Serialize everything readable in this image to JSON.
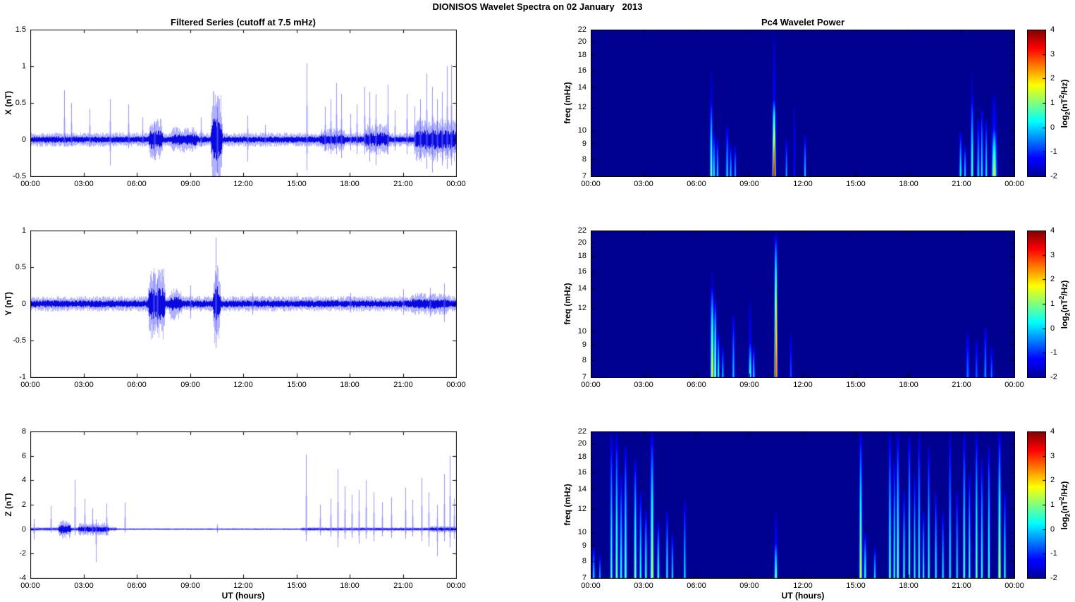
{
  "figure": {
    "title": "DIONISOS Wavelet Spectra on 02 January   2013",
    "background_color": "#ffffff",
    "series_color": "#0000ee",
    "frame_color": "#000000",
    "heatmap_background": "#00008f"
  },
  "chart_data": [
    {
      "id": "x-filtered-series",
      "type": "line",
      "title": "Filtered Series (cutoff at 7.5 mHz)",
      "xlabel": "",
      "ylabel": "X (nT)",
      "xlim_hours": [
        0,
        24
      ],
      "x_tick_labels": [
        "00:00",
        "03:00",
        "06:00",
        "09:00",
        "12:00",
        "15:00",
        "18:00",
        "21:00",
        "00:00"
      ],
      "ylim": [
        -0.5,
        1.5
      ],
      "y_tick_labels": [
        "1.5",
        "1",
        "0.5",
        "0",
        "-0.5"
      ],
      "seed": 7,
      "noise_base": 0.055,
      "noise_bursts": [
        [
          6.75,
          7.35,
          0.16
        ],
        [
          8.0,
          9.3,
          0.1
        ],
        [
          10.25,
          10.7,
          0.38
        ],
        [
          16.4,
          17.6,
          0.09
        ],
        [
          18.9,
          20.1,
          0.12
        ],
        [
          21.7,
          23.9,
          0.17
        ]
      ],
      "spikes": [
        [
          1.9,
          0.67,
          -0.1
        ],
        [
          2.3,
          0.5,
          -0.08
        ],
        [
          3.35,
          0.42,
          -0.1
        ],
        [
          4.5,
          0.55,
          -0.35
        ],
        [
          5.5,
          0.48,
          -0.12
        ],
        [
          6.3,
          0.3,
          -0.1
        ],
        [
          7.0,
          0.25,
          -0.28
        ],
        [
          9.6,
          0.3,
          -0.1
        ],
        [
          10.5,
          0.45,
          -0.45
        ],
        [
          12.2,
          0.33,
          -0.3
        ],
        [
          13.2,
          0.2,
          -0.1
        ],
        [
          15.55,
          1.04,
          -0.42
        ],
        [
          16.6,
          0.45,
          -0.15
        ],
        [
          16.9,
          0.55,
          -0.2
        ],
        [
          17.2,
          0.77,
          -0.2
        ],
        [
          17.5,
          0.62,
          -0.25
        ],
        [
          18.0,
          0.35,
          -0.15
        ],
        [
          18.35,
          0.48,
          -0.2
        ],
        [
          18.8,
          0.72,
          -0.2
        ],
        [
          19.1,
          0.65,
          -0.3
        ],
        [
          19.45,
          0.62,
          -0.35
        ],
        [
          20.1,
          0.75,
          -0.2
        ],
        [
          20.5,
          0.4,
          -0.15
        ],
        [
          21.2,
          0.62,
          -0.2
        ],
        [
          21.6,
          0.45,
          -0.2
        ],
        [
          21.95,
          0.55,
          -0.25
        ],
        [
          22.3,
          0.9,
          -0.4
        ],
        [
          22.6,
          0.72,
          -0.45
        ],
        [
          22.9,
          0.55,
          -0.3
        ],
        [
          23.15,
          0.65,
          -0.35
        ],
        [
          23.45,
          1.0,
          -0.4
        ],
        [
          23.7,
          1.02,
          -0.35
        ]
      ]
    },
    {
      "id": "y-filtered-series",
      "type": "line",
      "title": "",
      "xlabel": "",
      "ylabel": "Y (nT)",
      "xlim_hours": [
        0,
        24
      ],
      "x_tick_labels": [
        "00:00",
        "03:00",
        "06:00",
        "09:00",
        "12:00",
        "15:00",
        "18:00",
        "21:00",
        "00:00"
      ],
      "ylim": [
        -1,
        1
      ],
      "y_tick_labels": [
        "1",
        "0.5",
        "0",
        "-0.5",
        "-1"
      ],
      "seed": 8,
      "noise_base": 0.06,
      "noise_bursts": [
        [
          6.7,
          7.5,
          0.28
        ],
        [
          7.9,
          8.4,
          0.13
        ],
        [
          10.35,
          10.6,
          0.3
        ],
        [
          21.5,
          23.5,
          0.085
        ]
      ],
      "spikes": [
        [
          6.95,
          0.42,
          -0.42
        ],
        [
          7.15,
          0.35,
          -0.3
        ],
        [
          9.0,
          0.25,
          -0.2
        ],
        [
          10.45,
          0.9,
          -0.6
        ],
        [
          12.5,
          0.15,
          -0.15
        ],
        [
          18.0,
          0.15,
          -0.12
        ],
        [
          21.0,
          0.2,
          -0.15
        ],
        [
          22.5,
          0.22,
          -0.18
        ],
        [
          23.3,
          0.28,
          -0.25
        ]
      ]
    },
    {
      "id": "z-filtered-series",
      "type": "line",
      "title": "",
      "xlabel": "UT (hours)",
      "ylabel": "Z (nT)",
      "xlim_hours": [
        0,
        24
      ],
      "x_tick_labels": [
        "00:00",
        "03:00",
        "06:00",
        "09:00",
        "12:00",
        "15:00",
        "18:00",
        "21:00",
        "00:00"
      ],
      "ylim": [
        -4,
        8
      ],
      "y_tick_labels": [
        "8",
        "6",
        "4",
        "2",
        "0",
        "-2",
        "-4"
      ],
      "seed": 9,
      "noise_base": 0.05,
      "noise_bursts": [
        [
          0.0,
          4.8,
          0.1
        ],
        [
          1.65,
          2.2,
          0.45
        ],
        [
          2.75,
          4.35,
          0.3
        ],
        [
          15.3,
          24,
          0.1
        ],
        [
          22.5,
          23.9,
          0.16
        ]
      ],
      "spikes": [
        [
          0.2,
          0.85,
          -0.85
        ],
        [
          1.15,
          1.9,
          -0.3
        ],
        [
          2.5,
          4.05,
          -0.5
        ],
        [
          3.05,
          2.5,
          -0.4
        ],
        [
          3.5,
          1.7,
          -0.4
        ],
        [
          3.7,
          0.8,
          -2.7
        ],
        [
          4.3,
          2.1,
          -0.5
        ],
        [
          5.3,
          2.2,
          -0.3
        ],
        [
          10.5,
          0.4,
          -0.3
        ],
        [
          15.5,
          6.1,
          -1.0
        ],
        [
          16.3,
          2.0,
          -0.5
        ],
        [
          16.9,
          2.5,
          -0.6
        ],
        [
          17.3,
          4.9,
          -1.5
        ],
        [
          17.7,
          3.5,
          -0.8
        ],
        [
          18.1,
          2.8,
          -0.7
        ],
        [
          18.5,
          3.2,
          -1.2
        ],
        [
          18.9,
          4.0,
          -0.8
        ],
        [
          19.3,
          3.0,
          -1.0
        ],
        [
          19.8,
          2.2,
          -0.6
        ],
        [
          20.3,
          2.6,
          -0.7
        ],
        [
          21.1,
          3.4,
          -0.8
        ],
        [
          21.5,
          2.4,
          -0.6
        ],
        [
          22.0,
          4.2,
          -1.0
        ],
        [
          22.4,
          3.0,
          -1.4
        ],
        [
          22.9,
          2.0,
          -2.2
        ],
        [
          23.3,
          4.5,
          -1.0
        ],
        [
          23.6,
          6.0,
          -1.5
        ],
        [
          23.85,
          2.5,
          -0.8
        ]
      ]
    },
    {
      "id": "x-wavelet-power",
      "type": "heatmap",
      "title": "Pc4 Wavelet Power",
      "xlabel": "",
      "ylabel": "freq (mHz)",
      "xlim_hours": [
        0,
        24
      ],
      "x_tick_labels": [
        "00:00",
        "03:00",
        "06:00",
        "09:00",
        "12:00",
        "15:00",
        "18:00",
        "21:00",
        "00:00"
      ],
      "freq_lim_mhz": [
        7,
        22
      ],
      "y_tick_labels": [
        "22",
        "20",
        "18",
        "16",
        "14",
        "12",
        "10",
        "9",
        "8",
        "7"
      ],
      "colorbar": {
        "min": -2,
        "max": 4,
        "tick_labels": [
          "4",
          "3",
          "2",
          "1",
          "0",
          "-1",
          "-2"
        ],
        "label_plain": "log2(nT^2/Hz)",
        "label_parts": {
          "prefix": "log",
          "sub": "2",
          "mid": "(nT",
          "sup": "2",
          "suffix": "/Hz)"
        }
      },
      "events": [
        [
          6.8,
          1.3,
          13,
          0.05
        ],
        [
          6.8,
          -0.9,
          16.5,
          0.05
        ],
        [
          6.95,
          0.7,
          10,
          0.04
        ],
        [
          7.15,
          0.4,
          9.5,
          0.04
        ],
        [
          7.7,
          0.3,
          10.5,
          0.05
        ],
        [
          7.9,
          0.25,
          9,
          0.04
        ],
        [
          8.15,
          0.1,
          9,
          0.04
        ],
        [
          10.35,
          3.9,
          13,
          0.055
        ],
        [
          10.35,
          -0.7,
          22,
          0.05
        ],
        [
          11.05,
          0.0,
          9.5,
          0.04
        ],
        [
          11.5,
          -1.0,
          12.5,
          0.035
        ],
        [
          12.1,
          0.3,
          9.8,
          0.04
        ],
        [
          20.9,
          0.5,
          10,
          0.05
        ],
        [
          21.15,
          0.4,
          9,
          0.04
        ],
        [
          21.55,
          1.0,
          13.5,
          0.05
        ],
        [
          21.55,
          -1.0,
          16,
          0.05
        ],
        [
          21.9,
          0.3,
          11,
          0.05
        ],
        [
          22.1,
          0.6,
          12,
          0.04
        ],
        [
          22.35,
          0.5,
          11,
          0.04
        ],
        [
          22.8,
          1.7,
          10.5,
          0.09
        ],
        [
          22.8,
          -0.5,
          13.5,
          0.08
        ]
      ]
    },
    {
      "id": "y-wavelet-power",
      "type": "heatmap",
      "title": "",
      "xlabel": "",
      "ylabel": "freq (mHz)",
      "xlim_hours": [
        0,
        24
      ],
      "x_tick_labels": [
        "00:00",
        "03:00",
        "06:00",
        "09:00",
        "12:00",
        "15:00",
        "18:00",
        "21:00",
        "00:00"
      ],
      "freq_lim_mhz": [
        7,
        22
      ],
      "y_tick_labels": [
        "22",
        "20",
        "18",
        "16",
        "14",
        "12",
        "10",
        "9",
        "8",
        "7"
      ],
      "colorbar": {
        "min": -2,
        "max": 4,
        "tick_labels": [
          "4",
          "3",
          "2",
          "1",
          "0",
          "-1",
          "-2"
        ],
        "label_plain": "log2(nT^2/Hz)",
        "label_parts": {
          "prefix": "log",
          "sub": "2",
          "mid": "(nT",
          "sup": "2",
          "suffix": "/Hz)"
        }
      },
      "events": [
        [
          6.85,
          2.1,
          14.5,
          0.06
        ],
        [
          6.85,
          -0.6,
          16.5,
          0.05
        ],
        [
          7.02,
          1.8,
          13,
          0.045
        ],
        [
          7.2,
          0.9,
          10,
          0.04
        ],
        [
          7.45,
          0.2,
          9,
          0.04
        ],
        [
          8.05,
          0.1,
          11.5,
          0.05
        ],
        [
          9.0,
          0.9,
          9.5,
          0.055
        ],
        [
          9.0,
          -0.9,
          13,
          0.05
        ],
        [
          9.2,
          0.4,
          9,
          0.04
        ],
        [
          10.45,
          3.7,
          21.5,
          0.05
        ],
        [
          10.45,
          1.5,
          22,
          0.03
        ],
        [
          11.3,
          -0.6,
          10,
          0.04
        ],
        [
          21.3,
          -0.4,
          10,
          0.06
        ],
        [
          21.8,
          -0.5,
          9.5,
          0.05
        ],
        [
          22.3,
          -0.1,
          10.5,
          0.05
        ],
        [
          22.65,
          -0.4,
          9,
          0.05
        ]
      ]
    },
    {
      "id": "z-wavelet-power",
      "type": "heatmap",
      "title": "",
      "xlabel": "UT (hours)",
      "ylabel": "freq (mHz)",
      "xlim_hours": [
        0,
        24
      ],
      "x_tick_labels": [
        "00:00",
        "03:00",
        "06:00",
        "09:00",
        "12:00",
        "15:00",
        "18:00",
        "21:00",
        "00:00"
      ],
      "freq_lim_mhz": [
        7,
        22
      ],
      "y_tick_labels": [
        "22",
        "20",
        "18",
        "16",
        "14",
        "12",
        "10",
        "9",
        "8",
        "7"
      ],
      "colorbar": {
        "min": -2,
        "max": 4,
        "tick_labels": [
          "4",
          "3",
          "2",
          "1",
          "0",
          "-1",
          "-2"
        ],
        "label_plain": "log2(nT^2/Hz)",
        "label_parts": {
          "prefix": "log",
          "sub": "2",
          "mid": "(nT",
          "sup": "2",
          "suffix": "/Hz)"
        }
      },
      "events": [
        [
          0.15,
          0.5,
          9,
          0.04
        ],
        [
          0.5,
          0.1,
          8.5,
          0.035
        ],
        [
          1.15,
          0.9,
          22,
          0.045
        ],
        [
          1.45,
          1.2,
          22,
          0.05
        ],
        [
          1.7,
          0.8,
          16,
          0.045
        ],
        [
          1.95,
          1.1,
          20,
          0.05
        ],
        [
          2.5,
          1.3,
          18,
          0.05
        ],
        [
          2.8,
          0.7,
          14,
          0.045
        ],
        [
          3.1,
          0.9,
          12,
          0.045
        ],
        [
          3.45,
          1.7,
          22,
          0.06
        ],
        [
          3.8,
          0.9,
          11,
          0.045
        ],
        [
          4.3,
          0.7,
          12,
          0.04
        ],
        [
          4.6,
          0.4,
          10,
          0.04
        ],
        [
          5.3,
          0.5,
          13,
          0.04
        ],
        [
          10.45,
          1.2,
          9.5,
          0.055
        ],
        [
          10.45,
          -0.8,
          12,
          0.05
        ],
        [
          15.25,
          1.8,
          22,
          0.05
        ],
        [
          15.5,
          0.9,
          10,
          0.045
        ],
        [
          16.05,
          0.5,
          9,
          0.04
        ],
        [
          16.9,
          1.1,
          22,
          0.045
        ],
        [
          17.15,
          0.9,
          18,
          0.04
        ],
        [
          17.35,
          1.4,
          22,
          0.045
        ],
        [
          17.7,
          0.9,
          14,
          0.04
        ],
        [
          18.0,
          1.1,
          22,
          0.04
        ],
        [
          18.3,
          0.7,
          16,
          0.04
        ],
        [
          18.55,
          0.9,
          22,
          0.04
        ],
        [
          18.8,
          0.7,
          12,
          0.04
        ],
        [
          19.1,
          0.9,
          20,
          0.04
        ],
        [
          19.5,
          0.7,
          14,
          0.04
        ],
        [
          19.9,
          0.5,
          12,
          0.04
        ],
        [
          20.3,
          0.7,
          22,
          0.04
        ],
        [
          20.7,
          0.5,
          14,
          0.04
        ],
        [
          21.1,
          1.1,
          22,
          0.045
        ],
        [
          21.4,
          0.9,
          16,
          0.04
        ],
        [
          21.8,
          1.3,
          22,
          0.045
        ],
        [
          22.1,
          0.9,
          18,
          0.04
        ],
        [
          22.5,
          1.1,
          20,
          0.04
        ],
        [
          23.1,
          1.9,
          22,
          0.05
        ],
        [
          23.4,
          0.9,
          14,
          0.04
        ]
      ]
    }
  ]
}
